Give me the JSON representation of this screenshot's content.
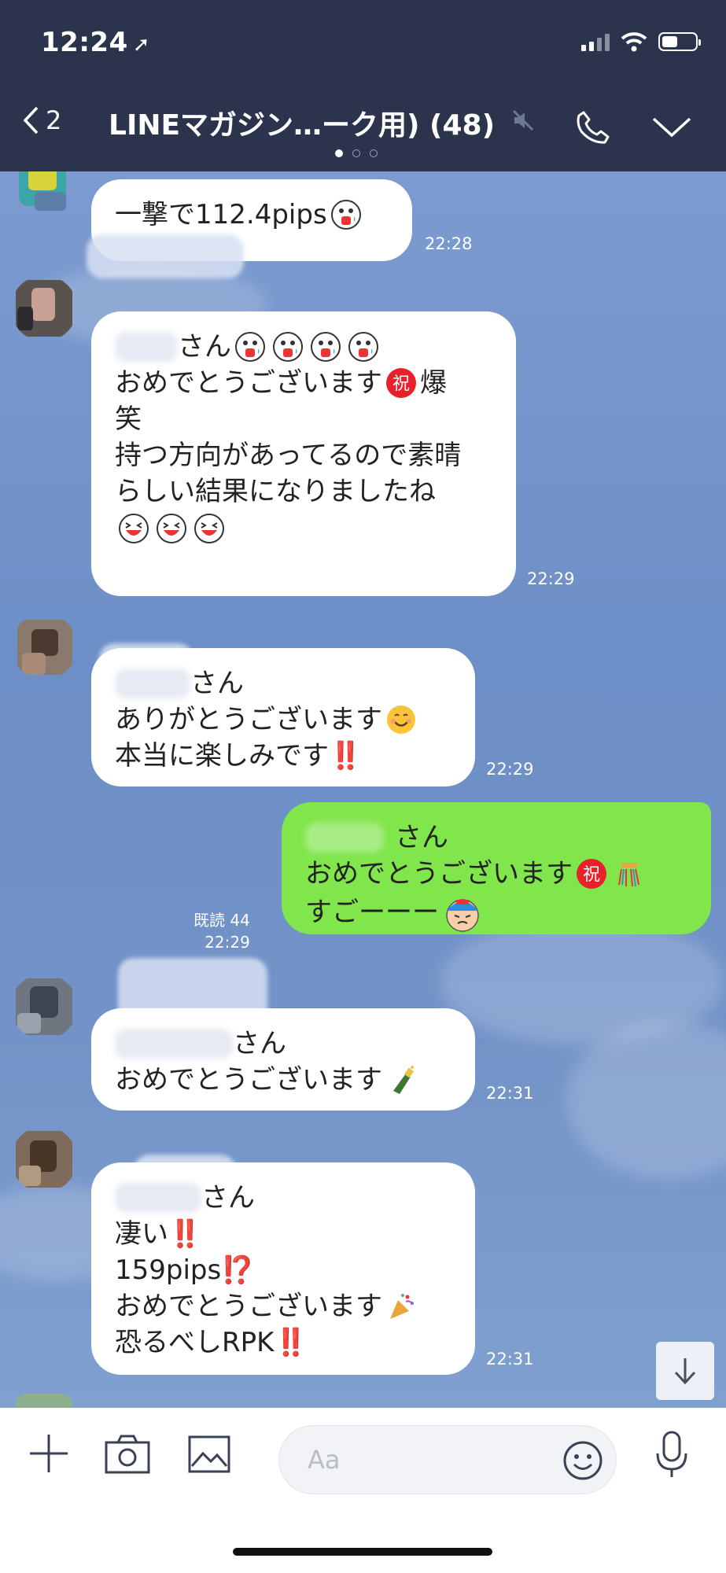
{
  "status_bar": {
    "time": "12:24",
    "location_icon": "location-arrow-icon",
    "signal_icon": "signal-icon",
    "wifi_icon": "wifi-icon",
    "battery_icon": "battery-icon"
  },
  "header": {
    "back_count": "2",
    "title": "LINEマガジン…ーク用) (48)",
    "mute_icon": "mute-icon",
    "call_icon": "phone-icon",
    "menu_icon": "chevron-down-icon"
  },
  "messages": [
    {
      "text_1": "一撃で112.4pips",
      "time": "22:28"
    },
    {
      "sender_suffix": "さん",
      "line_2": "おめでとうございます",
      "line_2b": "爆",
      "line_3": "笑",
      "line_4": "持つ方向があってるので素晴",
      "line_5": "らしい結果になりましたね",
      "time": "22:29"
    },
    {
      "sender_suffix": "さん",
      "line_2": "ありがとうございます",
      "line_3": "本当に楽しみです",
      "line_3_mark": "‼️",
      "time": "22:29"
    },
    {
      "sender_suffix": "さん",
      "line_2": "おめでとうございます",
      "line_3": "すごーーー",
      "read": "既読 44",
      "time": "22:29"
    },
    {
      "sender_suffix": "さん",
      "line_2": "おめでとうございます",
      "time": "22:31"
    },
    {
      "sender_suffix": "さん",
      "line_2": "凄い",
      "line_2_mark": "‼️",
      "line_3": "159pips",
      "line_3_mark": "⁉️",
      "line_4": "おめでとうございます",
      "line_5": "恐るべしRPK",
      "line_5_mark": "‼️",
      "time": "22:31"
    }
  ],
  "stamp_char": "祝",
  "input": {
    "placeholder": "Aa",
    "plus_icon": "plus-icon",
    "camera_icon": "camera-icon",
    "image_icon": "image-icon",
    "emoji_icon": "smiley-icon",
    "mic_icon": "microphone-icon"
  },
  "colors": {
    "header_bg": "#2c344d",
    "chat_bg": "#7393c6",
    "my_bubble": "#80e64b",
    "their_bubble": "#ffffff"
  }
}
